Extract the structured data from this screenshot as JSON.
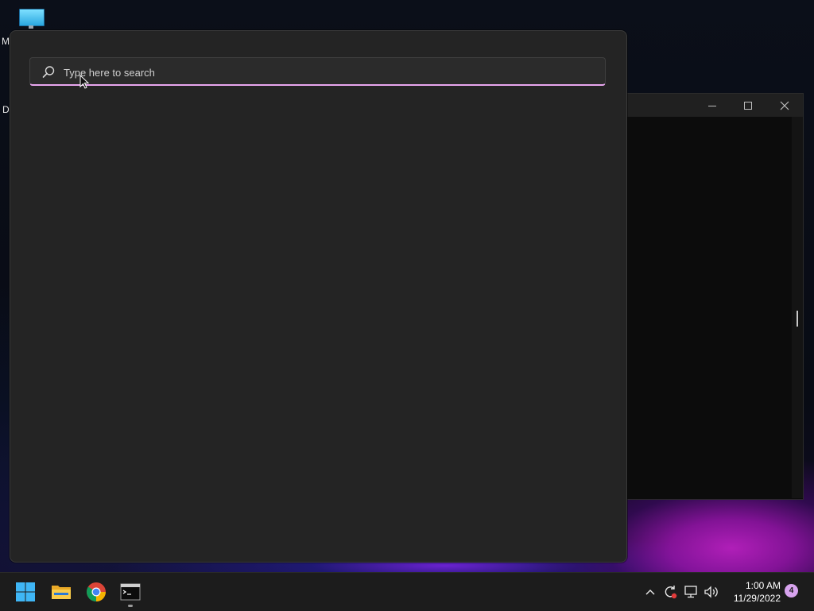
{
  "desktop": {
    "icons": [
      {
        "name": "monitor-icon",
        "label_fragment": "M"
      }
    ],
    "other_fragment": "D",
    "wallpaper_accent": "#b01fb8"
  },
  "background_window": {
    "controls": [
      "minimize-icon",
      "maximize-icon",
      "close-icon"
    ]
  },
  "start_menu": {
    "search": {
      "placeholder": "Type here to search",
      "value": "",
      "icon": "search-icon",
      "focus_accent": "#e8a6ef"
    }
  },
  "taskbar": {
    "pinned": [
      {
        "name": "start-button",
        "icon": "windows-logo-icon"
      },
      {
        "name": "file-explorer-button",
        "icon": "folder-icon"
      },
      {
        "name": "chrome-button",
        "icon": "chrome-icon"
      },
      {
        "name": "terminal-button",
        "icon": "terminal-icon",
        "running": true
      }
    ],
    "tray": {
      "icons": [
        "chevron-up-icon",
        "sync-icon",
        "network-icon",
        "volume-icon"
      ],
      "time": "1:00 AM",
      "date": "11/29/2022",
      "notification_count": "4",
      "badge_color": "#d7a3ee"
    }
  }
}
